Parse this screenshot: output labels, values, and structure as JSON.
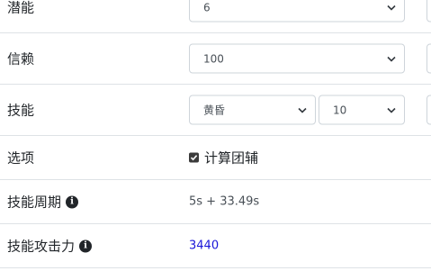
{
  "rows": [
    {
      "label": "潜能",
      "select": {
        "value": "6"
      }
    },
    {
      "label": "信赖",
      "select": {
        "value": "100"
      }
    },
    {
      "label": "技能",
      "skill_select": {
        "value": "黄昏"
      },
      "level_select": {
        "value": "10"
      }
    },
    {
      "label": "选项",
      "checkbox": {
        "label": "计算团辅",
        "checked": true
      }
    },
    {
      "label": "技能周期",
      "value": "5s + 33.49s"
    },
    {
      "label": "技能攻击力",
      "value": "3440",
      "value_color": "#1a16d9"
    }
  ],
  "icons": {
    "info": "info-icon",
    "chevron": "chevron-down-icon",
    "check": "check-icon"
  }
}
